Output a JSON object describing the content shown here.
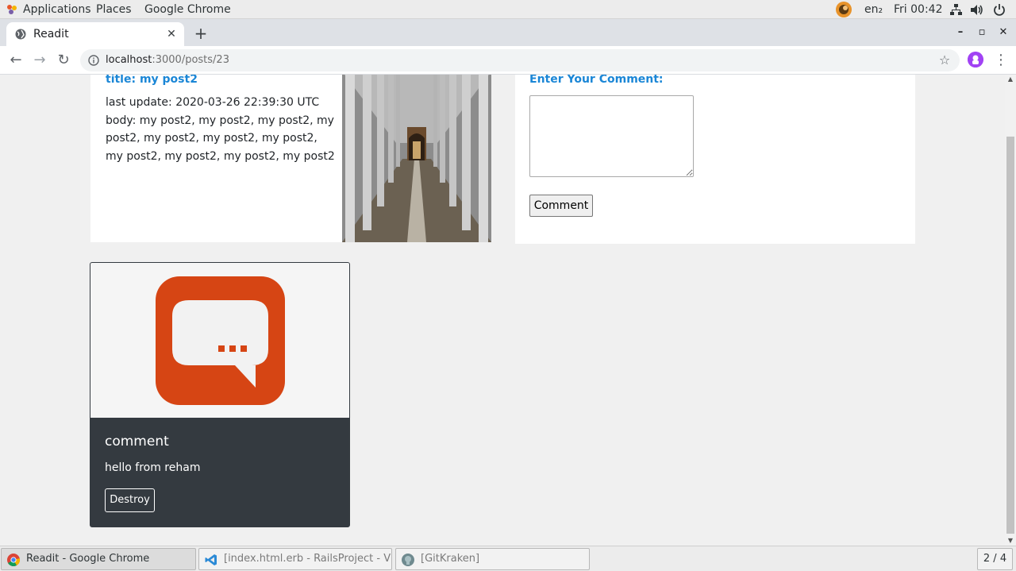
{
  "system_bar": {
    "applications": "Applications",
    "places": "Places",
    "app_name": "Google Chrome",
    "keyboard": "en₂",
    "clock": "Fri 00:42"
  },
  "browser": {
    "tab_title": "Readit",
    "url_host": "localhost",
    "url_path": ":3000/posts/23"
  },
  "post": {
    "title": "title: my post2",
    "last_update": "last update: 2020-03-26 22:39:30 UTC",
    "body": "body: my post2, my post2, my post2, my post2, my post2, my post2, my post2, my post2, my post2, my post2, my post2"
  },
  "comment_form": {
    "label": "Enter Your Comment:",
    "textarea_value": "",
    "submit_label": "Comment"
  },
  "comments": [
    {
      "title": "comment",
      "text": "hello from reham",
      "destroy_label": "Destroy"
    }
  ],
  "taskbar": {
    "items": [
      {
        "label": "Readit - Google Chrome",
        "icon": "chrome-icon",
        "active": true
      },
      {
        "label": "[index.html.erb - RailsProject - Visual...",
        "icon": "vscode-icon",
        "active": false
      },
      {
        "label": "[GitKraken]",
        "icon": "gitkraken-icon",
        "active": false
      }
    ],
    "workspace": "2 / 4"
  },
  "colors": {
    "accent_blue": "#1a86d6",
    "card_dark": "#343a40",
    "chat_icon_orange": "#d64514"
  }
}
